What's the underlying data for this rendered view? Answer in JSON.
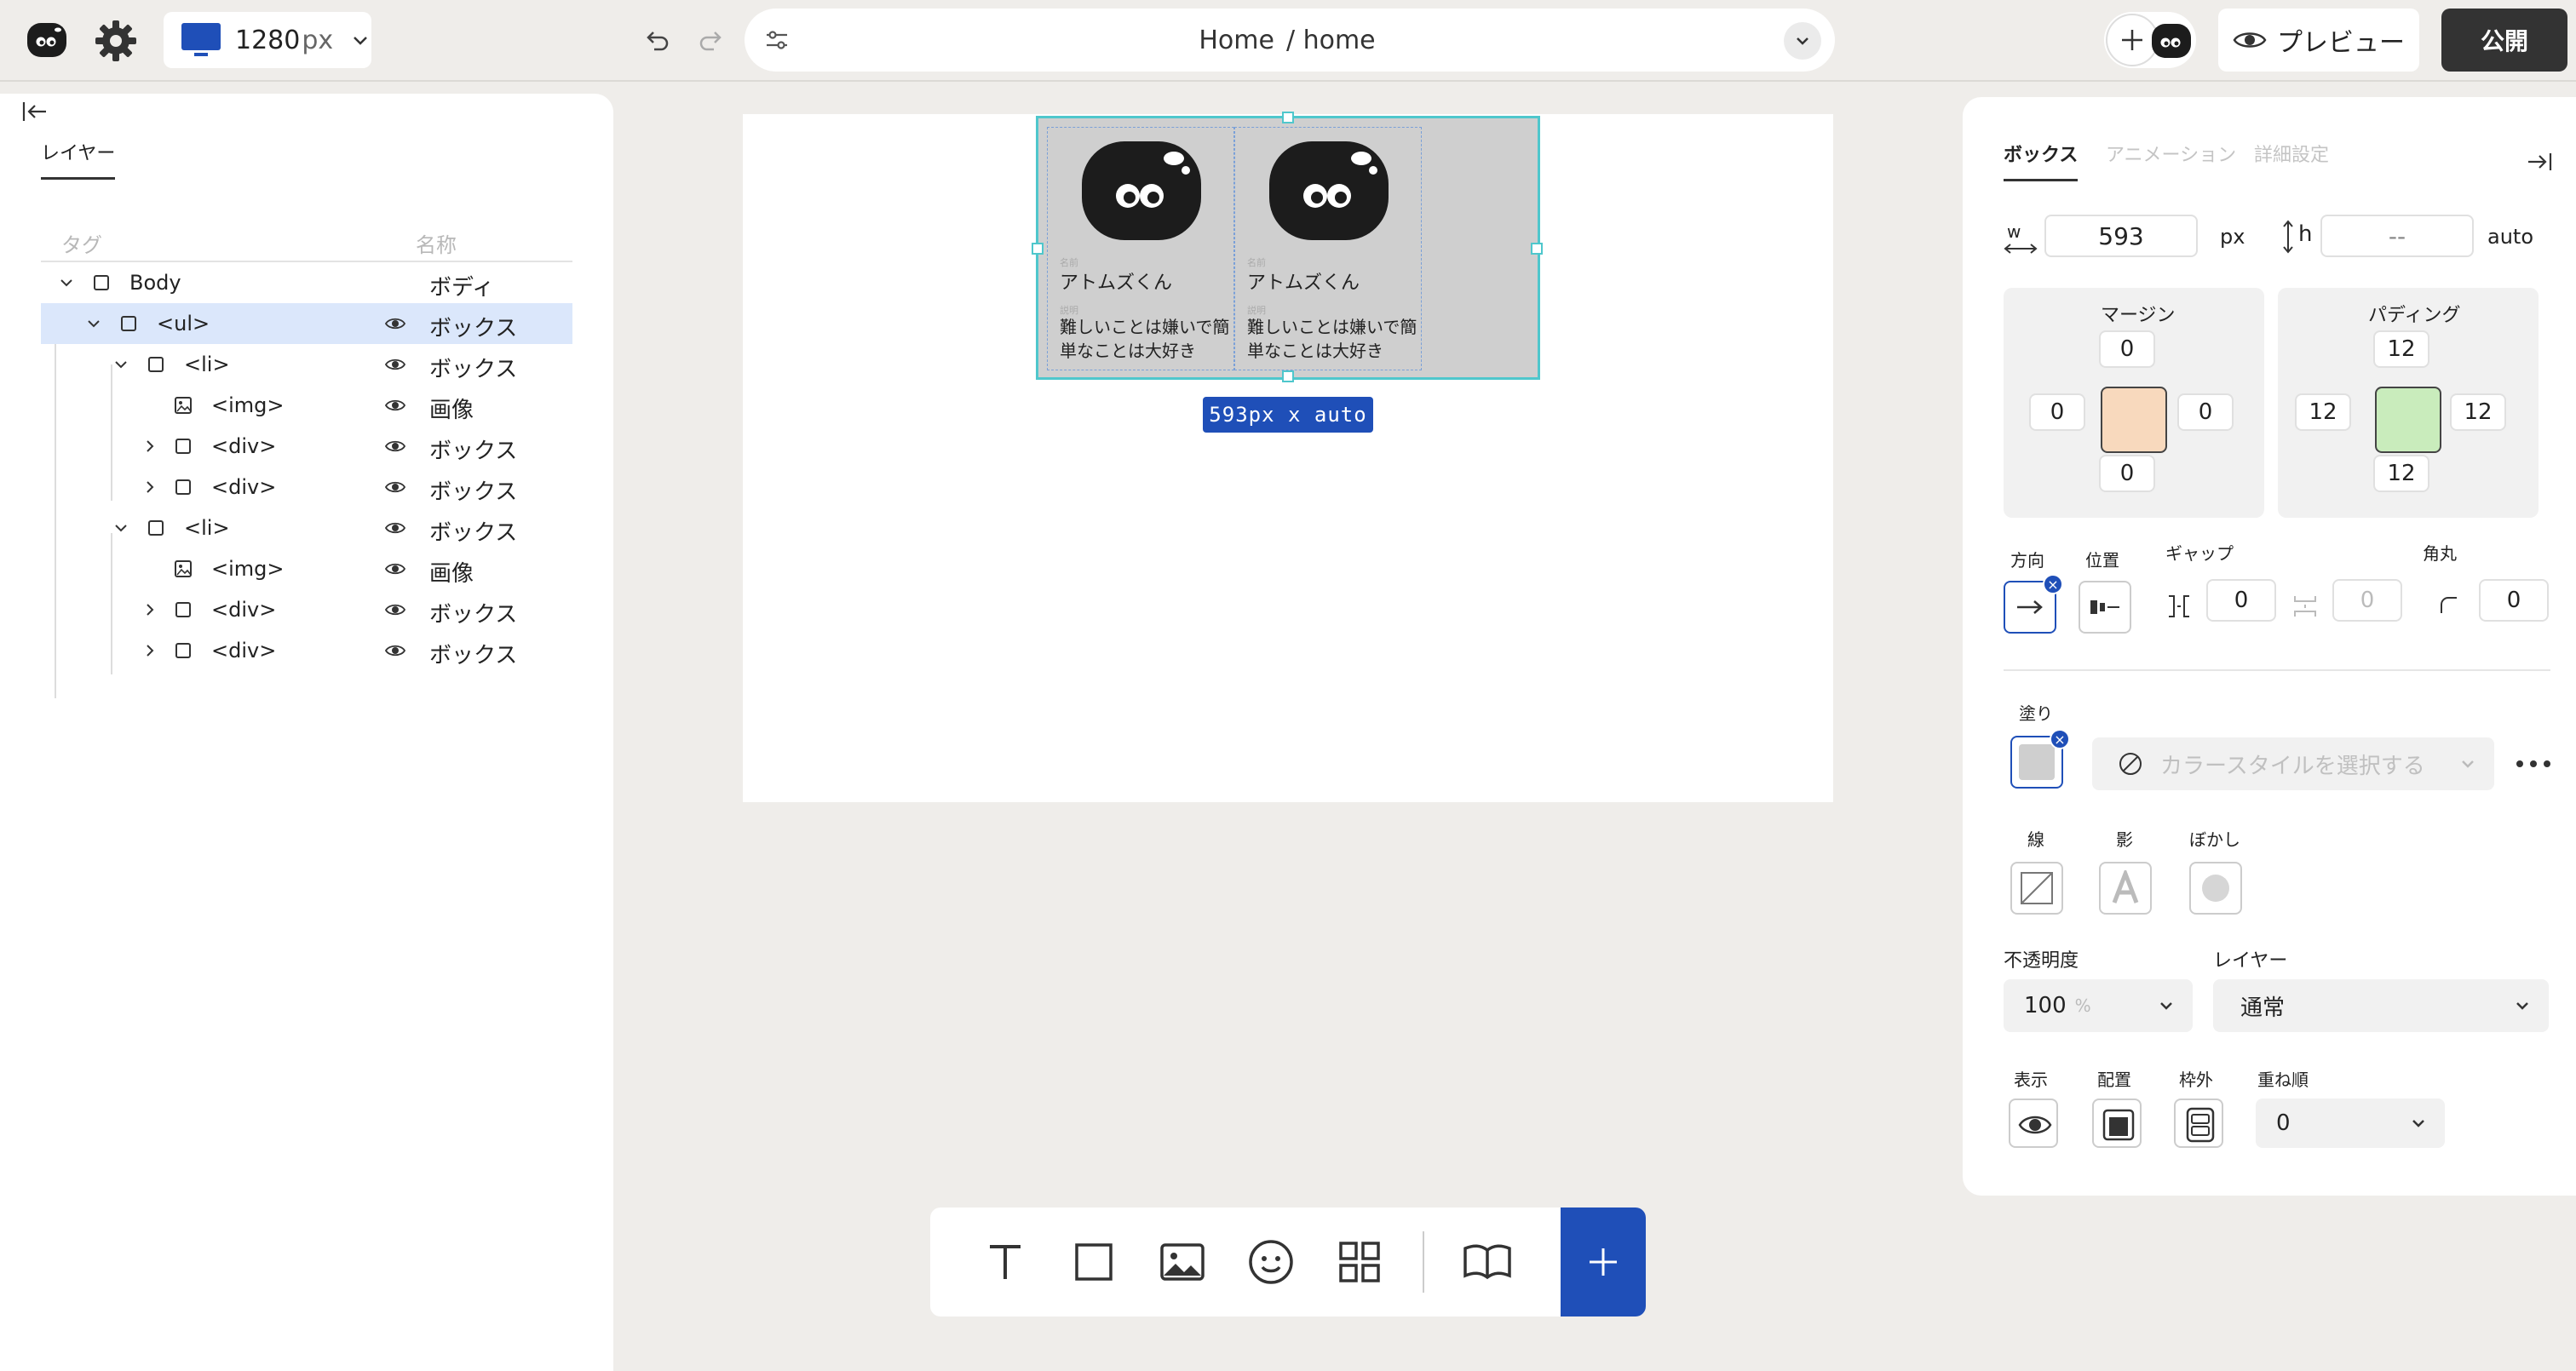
{
  "topbar": {
    "viewport_width": "1280",
    "viewport_unit": "px",
    "page_name": "Home",
    "page_path": "/ home",
    "preview_label": "プレビュー",
    "publish_label": "公開"
  },
  "left_panel": {
    "tab": "レイヤー",
    "col_tag": "タグ",
    "col_name": "名称",
    "rows": [
      {
        "tag": "Body",
        "name": "ボディ"
      },
      {
        "tag": "<ul>",
        "name": "ボックス"
      },
      {
        "tag": "<li>",
        "name": "ボックス"
      },
      {
        "tag": "<img>",
        "name": "画像"
      },
      {
        "tag": "<div>",
        "name": "ボックス"
      },
      {
        "tag": "<div>",
        "name": "ボックス"
      },
      {
        "tag": "<li>",
        "name": "ボックス"
      },
      {
        "tag": "<img>",
        "name": "画像"
      },
      {
        "tag": "<div>",
        "name": "ボックス"
      },
      {
        "tag": "<div>",
        "name": "ボックス"
      }
    ]
  },
  "canvas": {
    "cards": [
      {
        "tiny1": "名前",
        "name": "アトムズくん",
        "tiny2": "説明",
        "desc": "難しいことは嫌いで簡単なことは大好き"
      },
      {
        "tiny1": "名前",
        "name": "アトムズくん",
        "tiny2": "説明",
        "desc": "難しいことは嫌いで簡単なことは大好き"
      }
    ],
    "size_tag": "593px x auto"
  },
  "right_panel": {
    "tabs": [
      "ボックス",
      "アニメーション",
      "詳細設定"
    ],
    "w_label": "w",
    "w_value": "593",
    "w_unit": "px",
    "h_label": "h",
    "h_value": "--",
    "h_unit": "auto",
    "margin": {
      "label": "マージン",
      "top": "0",
      "left": "0",
      "right": "0",
      "bottom": "0"
    },
    "padding": {
      "label": "パディング",
      "top": "12",
      "left": "12",
      "right": "12",
      "bottom": "12"
    },
    "direction_label": "方向",
    "position_label": "位置",
    "gap_label": "ギャップ",
    "gap_value": "0",
    "gap2_value": "0",
    "radius_label": "角丸",
    "radius_value": "0",
    "fill_label": "塗り",
    "color_style_placeholder": "カラースタイルを選択する",
    "stroke_label": "線",
    "shadow_label": "影",
    "blur_label": "ぼかし",
    "opacity_label": "不透明度",
    "opacity_value": "100",
    "opacity_unit": "%",
    "layer_label": "レイヤー",
    "layer_value": "通常",
    "visible_label": "表示",
    "layout_label": "配置",
    "overflow_label": "枠外",
    "zorder_label": "重ね順",
    "zorder_value": "0"
  },
  "colors": {
    "accent": "#1f4fb8",
    "selection": "#4fc7cc",
    "margin_swatch": "#f8d9bd",
    "padding_swatch": "#c9ecbc",
    "canvas_bg": "#efedea"
  }
}
